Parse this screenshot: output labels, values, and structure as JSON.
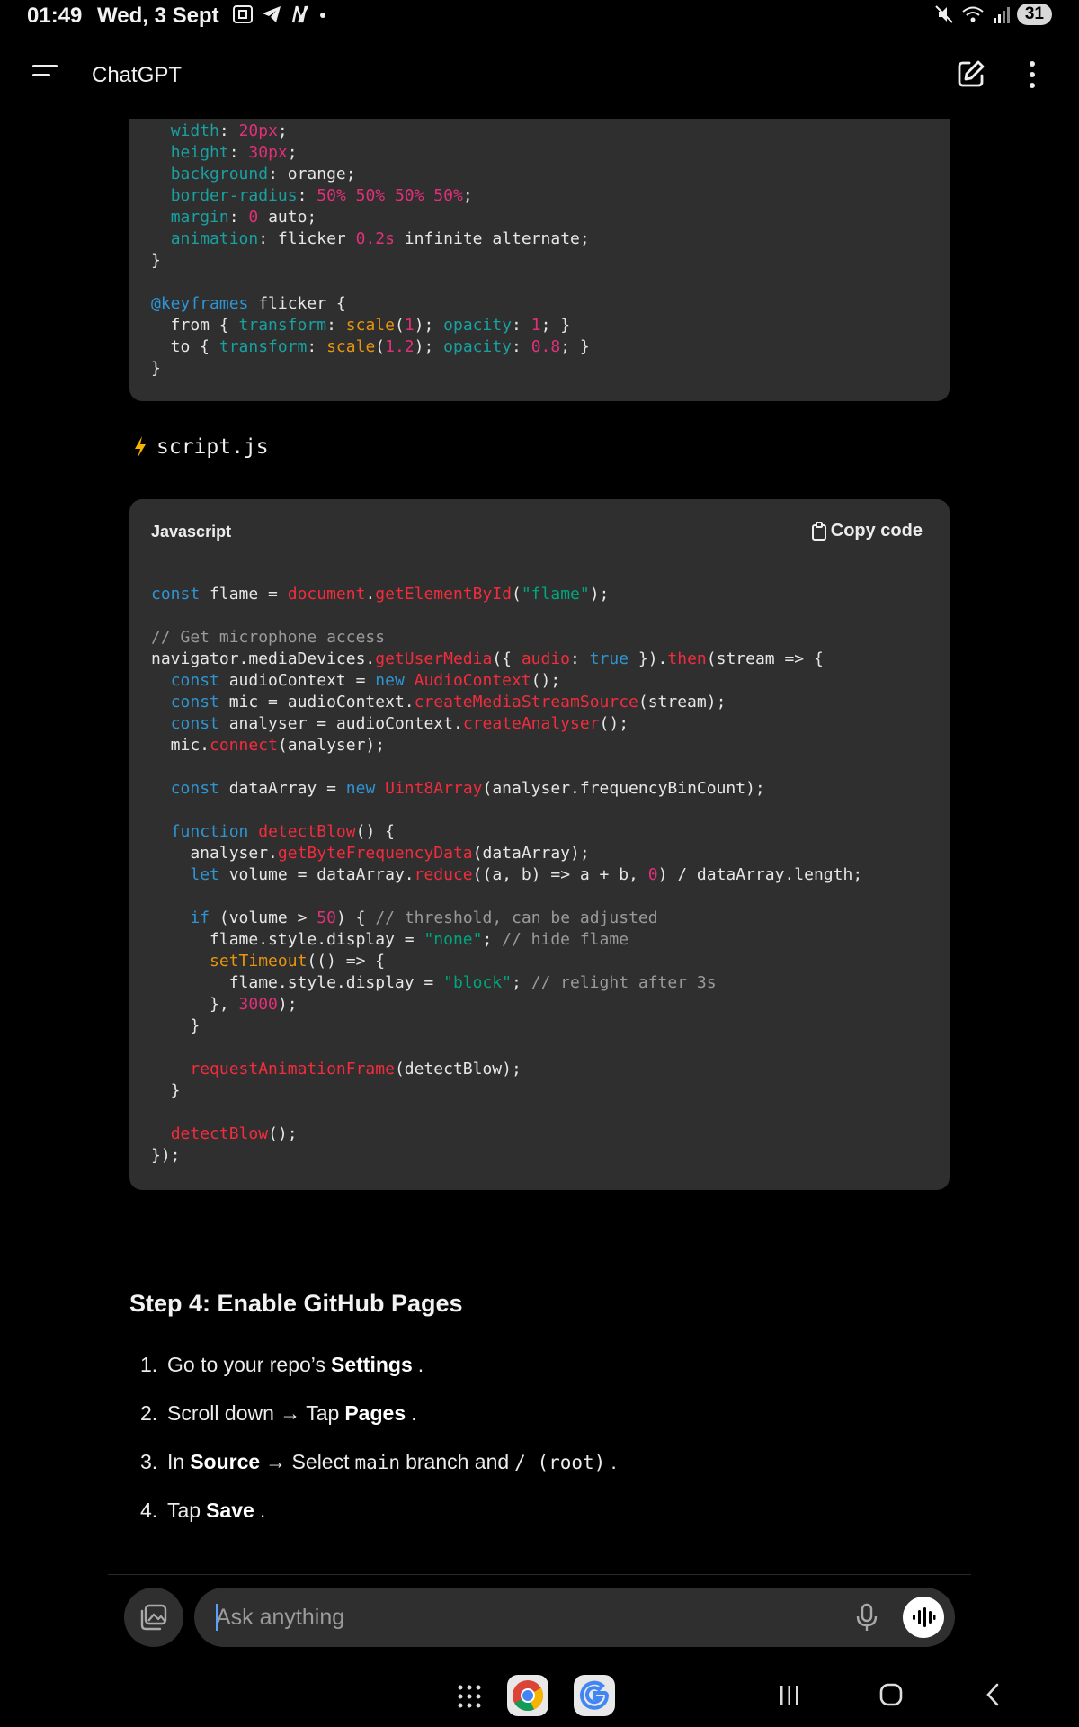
{
  "status_bar": {
    "time": "01:49",
    "date": "Wed, 3 Sept",
    "battery": "31"
  },
  "app_bar": {
    "title": "ChatGPT"
  },
  "css_code_lines": [
    [
      [
        "  ",
        "pl"
      ],
      [
        "width",
        "prop"
      ],
      [
        ": ",
        "pl"
      ],
      [
        "20px",
        "num"
      ],
      [
        ";",
        "pl"
      ]
    ],
    [
      [
        "  ",
        "pl"
      ],
      [
        "height",
        "prop"
      ],
      [
        ": ",
        "pl"
      ],
      [
        "30px",
        "num"
      ],
      [
        ";",
        "pl"
      ]
    ],
    [
      [
        "  ",
        "pl"
      ],
      [
        "background",
        "prop"
      ],
      [
        ": orange;",
        "pl"
      ]
    ],
    [
      [
        "  ",
        "pl"
      ],
      [
        "border-radius",
        "prop"
      ],
      [
        ": ",
        "pl"
      ],
      [
        "50% 50% 50% 50%",
        "num"
      ],
      [
        ";",
        "pl"
      ]
    ],
    [
      [
        "  ",
        "pl"
      ],
      [
        "margin",
        "prop"
      ],
      [
        ": ",
        "pl"
      ],
      [
        "0",
        "num"
      ],
      [
        " auto;",
        "pl"
      ]
    ],
    [
      [
        "  ",
        "pl"
      ],
      [
        "animation",
        "prop"
      ],
      [
        ": flicker ",
        "pl"
      ],
      [
        "0.2s",
        "num"
      ],
      [
        " infinite alternate;",
        "pl"
      ]
    ],
    [
      [
        "}",
        "pl"
      ]
    ],
    [
      [
        "",
        "pl"
      ]
    ],
    [
      [
        "@keyframes",
        "kw"
      ],
      [
        " flicker {",
        "pl"
      ]
    ],
    [
      [
        "  from { ",
        "pl"
      ],
      [
        "transform",
        "prop"
      ],
      [
        ": ",
        "pl"
      ],
      [
        "scale",
        "or"
      ],
      [
        "(",
        "pl"
      ],
      [
        "1",
        "num"
      ],
      [
        "); ",
        "pl"
      ],
      [
        "opacity",
        "prop"
      ],
      [
        ": ",
        "pl"
      ],
      [
        "1",
        "num"
      ],
      [
        "; }",
        "pl"
      ]
    ],
    [
      [
        "  to { ",
        "pl"
      ],
      [
        "transform",
        "prop"
      ],
      [
        ": ",
        "pl"
      ],
      [
        "scale",
        "or"
      ],
      [
        "(",
        "pl"
      ],
      [
        "1.2",
        "num"
      ],
      [
        "); ",
        "pl"
      ],
      [
        "opacity",
        "prop"
      ],
      [
        ": ",
        "pl"
      ],
      [
        "0.8",
        "num"
      ],
      [
        "; }",
        "pl"
      ]
    ],
    [
      [
        "}",
        "pl"
      ]
    ]
  ],
  "file_heading": {
    "name": "script.js"
  },
  "js_block": {
    "language": "Javascript",
    "copy_label": "Copy code"
  },
  "js_code_lines": [
    [
      [
        "const",
        "kw"
      ],
      [
        " flame = ",
        "pl"
      ],
      [
        "document",
        "fn"
      ],
      [
        ".",
        "pl"
      ],
      [
        "getElementById",
        "fn"
      ],
      [
        "(",
        "pl"
      ],
      [
        "\"flame\"",
        "str"
      ],
      [
        ");",
        "pl"
      ]
    ],
    [
      [
        "",
        "pl"
      ]
    ],
    [
      [
        "// Get microphone access",
        "com"
      ]
    ],
    [
      [
        "navigator.mediaDevices.",
        "pl"
      ],
      [
        "getUserMedia",
        "fn"
      ],
      [
        "({ ",
        "pl"
      ],
      [
        "audio",
        "fn"
      ],
      [
        ": ",
        "pl"
      ],
      [
        "true",
        "kw"
      ],
      [
        " }).",
        "pl"
      ],
      [
        "then",
        "fn"
      ],
      [
        "(stream => {",
        "pl"
      ]
    ],
    [
      [
        "  ",
        "pl"
      ],
      [
        "const",
        "kw"
      ],
      [
        " audioContext = ",
        "pl"
      ],
      [
        "new",
        "kw"
      ],
      [
        " ",
        "pl"
      ],
      [
        "AudioContext",
        "fn"
      ],
      [
        "();",
        "pl"
      ]
    ],
    [
      [
        "  ",
        "pl"
      ],
      [
        "const",
        "kw"
      ],
      [
        " mic = audioContext.",
        "pl"
      ],
      [
        "createMediaStreamSource",
        "fn"
      ],
      [
        "(stream);",
        "pl"
      ]
    ],
    [
      [
        "  ",
        "pl"
      ],
      [
        "const",
        "kw"
      ],
      [
        " analyser = audioContext.",
        "pl"
      ],
      [
        "createAnalyser",
        "fn"
      ],
      [
        "();",
        "pl"
      ]
    ],
    [
      [
        "  mic.",
        "pl"
      ],
      [
        "connect",
        "fn"
      ],
      [
        "(analyser);",
        "pl"
      ]
    ],
    [
      [
        "",
        "pl"
      ]
    ],
    [
      [
        "  ",
        "pl"
      ],
      [
        "const",
        "kw"
      ],
      [
        " dataArray = ",
        "pl"
      ],
      [
        "new",
        "kw"
      ],
      [
        " ",
        "pl"
      ],
      [
        "Uint8Array",
        "fn"
      ],
      [
        "(analyser.frequencyBinCount);",
        "pl"
      ]
    ],
    [
      [
        "",
        "pl"
      ]
    ],
    [
      [
        "  ",
        "pl"
      ],
      [
        "function",
        "kw"
      ],
      [
        " ",
        "pl"
      ],
      [
        "detectBlow",
        "fn"
      ],
      [
        "() {",
        "pl"
      ]
    ],
    [
      [
        "    analyser.",
        "pl"
      ],
      [
        "getByteFrequencyData",
        "fn"
      ],
      [
        "(dataArray);",
        "pl"
      ]
    ],
    [
      [
        "    ",
        "pl"
      ],
      [
        "let",
        "kw"
      ],
      [
        " volume = dataArray.",
        "pl"
      ],
      [
        "reduce",
        "fn"
      ],
      [
        "((a, b) => a + b, ",
        "pl"
      ],
      [
        "0",
        "num"
      ],
      [
        ") / dataArray.length;",
        "pl"
      ]
    ],
    [
      [
        "",
        "pl"
      ]
    ],
    [
      [
        "    ",
        "pl"
      ],
      [
        "if",
        "kw"
      ],
      [
        " (volume > ",
        "pl"
      ],
      [
        "50",
        "num"
      ],
      [
        ") { ",
        "pl"
      ],
      [
        "// threshold, can be adjusted",
        "com"
      ]
    ],
    [
      [
        "      flame.style.display = ",
        "pl"
      ],
      [
        "\"none\"",
        "str"
      ],
      [
        "; ",
        "pl"
      ],
      [
        "// hide flame",
        "com"
      ]
    ],
    [
      [
        "      ",
        "pl"
      ],
      [
        "setTimeout",
        "or"
      ],
      [
        "(() => {",
        "pl"
      ]
    ],
    [
      [
        "        flame.style.display = ",
        "pl"
      ],
      [
        "\"block\"",
        "str"
      ],
      [
        "; ",
        "pl"
      ],
      [
        "// relight after 3s",
        "com"
      ]
    ],
    [
      [
        "      }, ",
        "pl"
      ],
      [
        "3000",
        "num"
      ],
      [
        ");",
        "pl"
      ]
    ],
    [
      [
        "    }",
        "pl"
      ]
    ],
    [
      [
        "",
        "pl"
      ]
    ],
    [
      [
        "    ",
        "pl"
      ],
      [
        "requestAnimationFrame",
        "fn"
      ],
      [
        "(detectBlow);",
        "pl"
      ]
    ],
    [
      [
        "  }",
        "pl"
      ]
    ],
    [
      [
        "",
        "pl"
      ]
    ],
    [
      [
        "  ",
        "pl"
      ],
      [
        "detectBlow",
        "fn"
      ],
      [
        "();",
        "pl"
      ]
    ],
    [
      [
        "});",
        "pl"
      ]
    ]
  ],
  "step4": {
    "heading": "Step 4: Enable GitHub Pages",
    "item1": {
      "num": "1.",
      "pre": "Go to your repo’s",
      "bold": "Settings",
      "post": "."
    },
    "item2": {
      "num": "2.",
      "pre": "Scroll down → Tap",
      "bold": "Pages",
      "post": "."
    },
    "item3": {
      "num": "3.",
      "pre": "In",
      "bold": "Source",
      "mid": "→ Select",
      "code1": "main",
      "mid2": "branch and",
      "code2": "/ (root)",
      "post": "."
    },
    "item4": {
      "num": "4.",
      "pre": "Tap",
      "bold": "Save",
      "post": "."
    }
  },
  "composer": {
    "placeholder": "Ask anything"
  },
  "colors": {
    "background": "#000000",
    "code_bg": "#2f2f2f",
    "keyword": "#2e95d3",
    "function": "#f22c3d",
    "string": "#00a67d",
    "number": "#df3079",
    "property": "#19a0a0",
    "comment": "#9a9a9a"
  },
  "icons": [
    "menu-icon",
    "new-chat-icon",
    "more-vert-icon",
    "bolt-icon",
    "clipboard-icon",
    "attach-image-icon",
    "mic-icon",
    "voice-mode-icon",
    "apps-grid-icon",
    "chrome-icon",
    "google-icon",
    "recents-icon",
    "home-icon",
    "back-icon"
  ]
}
